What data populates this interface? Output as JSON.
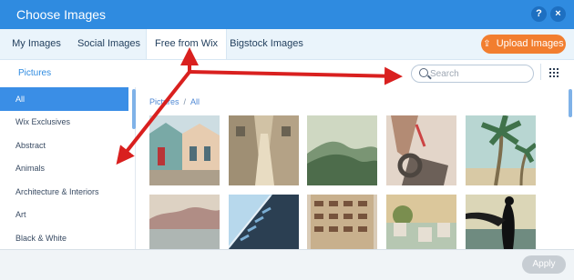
{
  "window": {
    "title": "Choose Images",
    "help": "?",
    "close": "×"
  },
  "tabs": [
    "My Images",
    "Social Images",
    "Free from Wix",
    "Bigstock Images"
  ],
  "upload": {
    "label": "Upload Images",
    "icon": "upload-icon"
  },
  "subnav": {
    "pictures": "Pictures"
  },
  "search": {
    "placeholder": "Search"
  },
  "sidebar": {
    "items": [
      "All",
      "Wix Exclusives",
      "Abstract",
      "Animals",
      "Architecture & Interiors",
      "Art",
      "Black & White"
    ]
  },
  "breadcrumb": {
    "root": "Pictures",
    "current": "All"
  },
  "footer": {
    "apply": "Apply"
  },
  "colors": {
    "titlebar": "#2f8be0",
    "accent": "#3a8ee6",
    "upload": "#f27e2f",
    "annotation": "#d9201f"
  }
}
